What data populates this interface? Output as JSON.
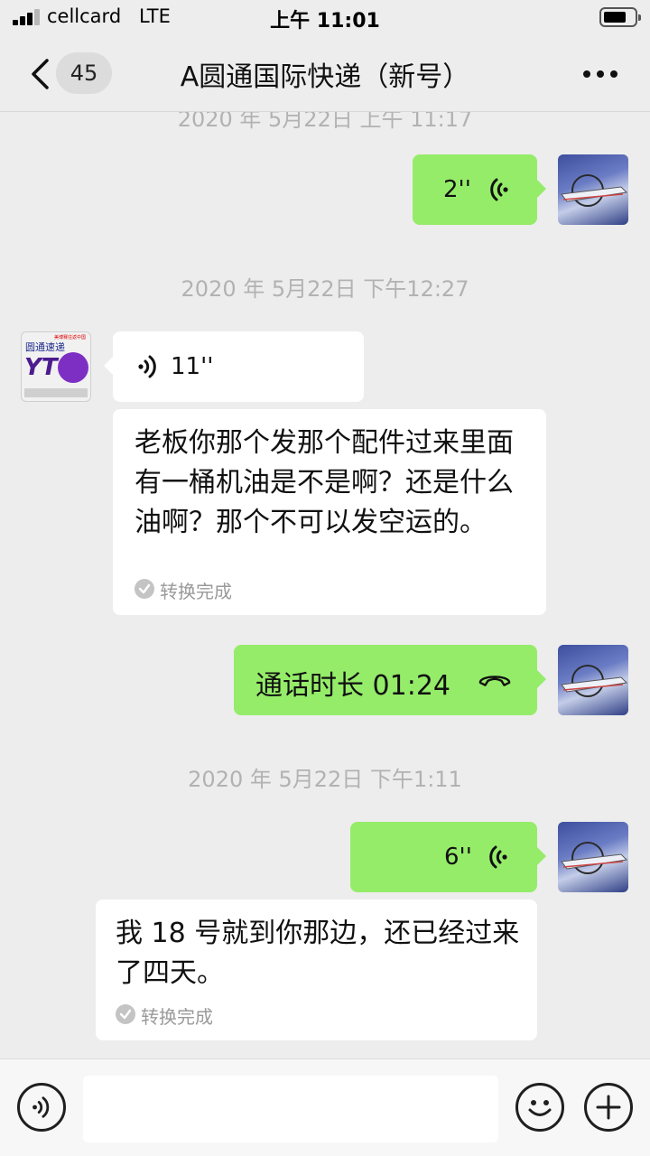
{
  "status_bar": {
    "carrier": "cellcard",
    "network": "LTE",
    "time": "上午 11:01"
  },
  "nav": {
    "unread_count": "45",
    "title": "A圆通国际快递（新号）"
  },
  "messages": {
    "partial_timestamp": "2020 年 5月22日 上午 11:17",
    "msg1_duration": "2''",
    "ts1": "2020 年 5月22日 下午12:27",
    "msg2_duration": "11''",
    "msg2_transcript": "老板你那个发那个配件过来里面有一桶机油是不是啊？还是什么油啊？那个不可以发空运的。",
    "msg2_status": "转换完成",
    "call_text": "通话时长 01:24",
    "ts2": "2020 年 5月22日 下午1:11",
    "msg4_duration": "6''",
    "msg4_transcript": "我 18 号就到你那边，还已经过来了四天。",
    "msg4_status": "转换完成"
  },
  "contact_logo": {
    "name": "圆通速递",
    "letters": "YT",
    "tagline": "美博赛往返中国"
  },
  "icons": {
    "voice_outgoing": "voice-wave-icon",
    "voice_incoming": "voice-wave-icon",
    "call": "phone-handset-icon",
    "voice_input": "voice-input-icon",
    "emoji": "emoji-icon",
    "add": "plus-icon"
  },
  "colors": {
    "self_bubble": "#95ec69",
    "other_bubble": "#ffffff",
    "background": "#ededed",
    "timestamp": "#b2b2b2"
  }
}
